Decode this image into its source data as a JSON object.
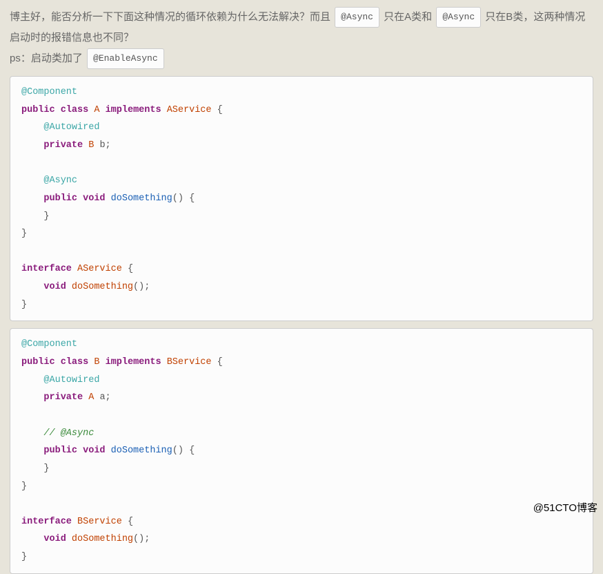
{
  "question": {
    "part1": "博主好，能否分析一下下面这种情况的循环依赖为什么无法解决？而且 ",
    "tag1": "@Async",
    "part2": " 只在A类和 ",
    "tag2": "@Async",
    "part3": " 只在B类，这两种情况启动时的报错信息也不同？",
    "ps_prefix": "ps：启动类加了 ",
    "ps_tag": "@EnableAsync"
  },
  "code1": {
    "anno1": "@Component",
    "decl_pub": "public",
    "decl_class": "class",
    "clsA": "A",
    "impl": "implements",
    "svcA": "AService",
    "autowired": "@Autowired",
    "private": "private",
    "typeB": "B",
    "varB": " b;",
    "async": "@Async",
    "pub2": "public",
    "void": "void",
    "method": "doSomething",
    "parens_body": "() {",
    "close_brace": "}",
    "iface_kw": "interface",
    "iface_name": "AService",
    "iface_open": " {",
    "iface_void": "void",
    "iface_method": "doSomething",
    "iface_call_end": "();"
  },
  "code2": {
    "anno1": "@Component",
    "decl_pub": "public",
    "decl_class": "class",
    "clsB": "B",
    "impl": "implements",
    "svcB": "BService",
    "autowired": "@Autowired",
    "private": "private",
    "typeA": "A",
    "varA": " a;",
    "comment": "// @Async",
    "pub2": "public",
    "void": "void",
    "method": "doSomething",
    "parens_body": "() {",
    "close_brace": "}",
    "iface_kw": "interface",
    "iface_name": "BService",
    "iface_open": " {",
    "iface_void": "void",
    "iface_method": "doSomething",
    "iface_call_end": "();"
  },
  "watermark": "@51CTO博客"
}
